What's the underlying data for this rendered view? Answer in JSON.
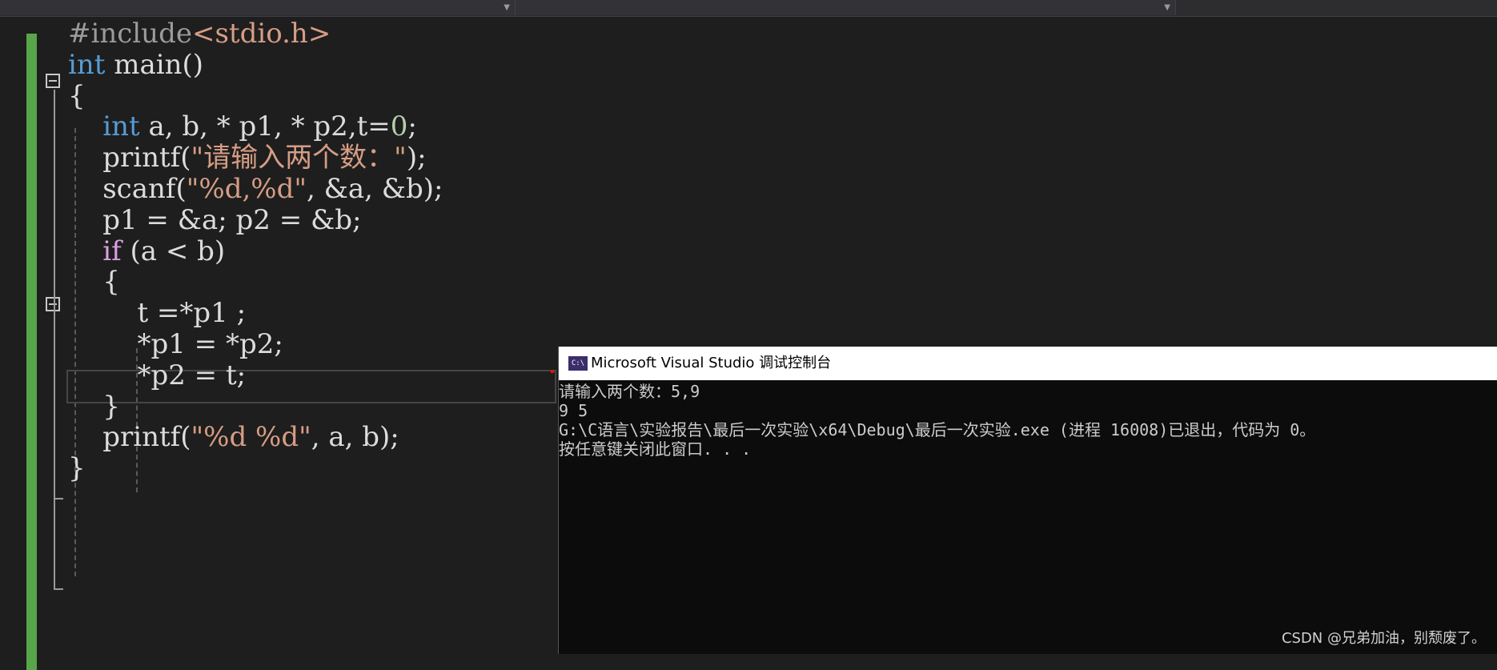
{
  "editor": {
    "lines": [
      {
        "id": "l1",
        "segments": [
          {
            "t": "#include",
            "c": "pp"
          },
          {
            "t": "<stdio.h>",
            "c": "str"
          }
        ]
      },
      {
        "id": "l2",
        "segments": [
          {
            "t": "int",
            "c": "kw"
          },
          {
            "t": " main()",
            "c": ""
          }
        ]
      },
      {
        "id": "l3",
        "segments": [
          {
            "t": "{",
            "c": ""
          }
        ]
      },
      {
        "id": "l4",
        "segments": [
          {
            "t": "    ",
            "c": ""
          },
          {
            "t": "int",
            "c": "kw"
          },
          {
            "t": " a, b, * p1, * p2,t=",
            "c": ""
          },
          {
            "t": "0",
            "c": "num"
          },
          {
            "t": ";",
            "c": ""
          }
        ]
      },
      {
        "id": "l5",
        "segments": [
          {
            "t": "    printf(",
            "c": ""
          },
          {
            "t": "\"请输入两个数：\"",
            "c": "str"
          },
          {
            "t": ");",
            "c": ""
          }
        ]
      },
      {
        "id": "l6",
        "segments": [
          {
            "t": "    scanf(",
            "c": ""
          },
          {
            "t": "\"%d,%d\"",
            "c": "str"
          },
          {
            "t": ", &a, &b);",
            "c": ""
          }
        ]
      },
      {
        "id": "l7",
        "segments": [
          {
            "t": "    p1 = &a; p2 = &b;",
            "c": ""
          }
        ]
      },
      {
        "id": "l8",
        "segments": [
          {
            "t": "    ",
            "c": ""
          },
          {
            "t": "if",
            "c": "kw-ctl"
          },
          {
            "t": " (a < b)",
            "c": ""
          }
        ]
      },
      {
        "id": "l9",
        "segments": [
          {
            "t": "    {",
            "c": ""
          }
        ]
      },
      {
        "id": "l10",
        "segments": [
          {
            "t": "        t =*p1 ;",
            "c": ""
          }
        ]
      },
      {
        "id": "l11",
        "segments": [
          {
            "t": "        *p1 = *p2;",
            "c": ""
          }
        ]
      },
      {
        "id": "l12",
        "segments": [
          {
            "t": "        *p2 = t;",
            "c": ""
          }
        ]
      },
      {
        "id": "l13",
        "segments": [
          {
            "t": "    }",
            "c": ""
          }
        ]
      },
      {
        "id": "l14",
        "segments": [
          {
            "t": "    printf(",
            "c": ""
          },
          {
            "t": "\"%d %d\"",
            "c": "str"
          },
          {
            "t": ", a, b);",
            "c": ""
          }
        ]
      },
      {
        "id": "l15",
        "segments": [
          {
            "t": "}",
            "c": ""
          }
        ]
      }
    ]
  },
  "console": {
    "title": "Microsoft Visual Studio 调试控制台",
    "icon_text": "C:\\",
    "output": [
      "请输入两个数：5,9",
      "9 5",
      "G:\\C语言\\实验报告\\最后一次实验\\x64\\Debug\\最后一次实验.exe (进程 16008)已退出，代码为 0。",
      "按任意键关闭此窗口. . ."
    ]
  },
  "watermark": "CSDN @兄弟加油，别颓废了。",
  "colors": {
    "keyword": "#569cd6",
    "control_keyword": "#d8a0df",
    "string": "#d69d85",
    "number": "#b5cea8",
    "preprocessor": "#9b9b9b",
    "change_bar": "#57a64a"
  }
}
